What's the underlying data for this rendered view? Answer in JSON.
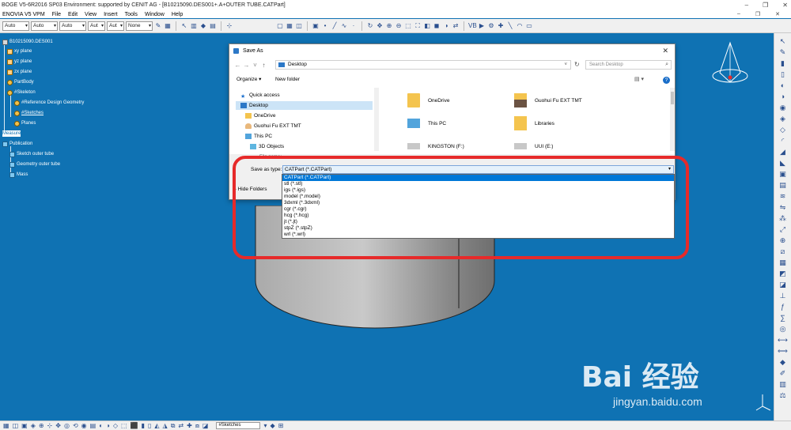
{
  "window": {
    "title": "BOGE V5-6R2016 SP03 Environment: supported by CENIT AG - [B10215090.DES001+.A+OUTER TUBE.CATPart]",
    "controls": [
      "–",
      "❐",
      "✕"
    ]
  },
  "menu": [
    "ENOVIA V5 VPM",
    "File",
    "Edit",
    "View",
    "Insert",
    "Tools",
    "Window",
    "Help"
  ],
  "menu_doc_controls": [
    "–",
    "❐",
    "✕"
  ],
  "toolbar_combos": [
    "Auto",
    "Auto",
    "Auto",
    "Aut",
    "Aut",
    "None"
  ],
  "tree": {
    "root": "B10215090.DES001",
    "xy": "xy plane",
    "yz": "yz plane",
    "zx": "zx plane",
    "partbody": "PartBody",
    "skeleton": "#Skeleton",
    "refgeo": "#Reference Design Geometry",
    "sketches": "#Sketches",
    "planes": "Planes",
    "measure": "Measure",
    "publication": "Publication",
    "sketch_outer": "Sketch outer tube",
    "geom_outer": "Geometry outer tube",
    "mass": "Mass"
  },
  "bottom_field": "#Sketches",
  "dialog": {
    "title": "Save As",
    "close": "✕",
    "location": "Desktop",
    "search_placeholder": "Search Desktop",
    "organize": "Organize ▾",
    "new_folder": "New folder",
    "help": "?",
    "nav": [
      "Quick access",
      "Desktop",
      "OneDrive",
      "Guohui Fu EXT TMT",
      "This PC",
      "3D Objects"
    ],
    "files": [
      "OneDrive",
      "Guohui Fu EXT TMT",
      "This PC",
      "Libraries",
      "KINGSTON (F:)",
      "UUI (E:)"
    ],
    "file_name_label": "File name:",
    "save_type_label": "Save as type:",
    "save_type_value": "CATPart (*.CATPart)",
    "hide_folders": "Hide Folders",
    "types": [
      "CATPart (*.CATPart)",
      "stl (*.stl)",
      "igs (*.igs)",
      "model (*.model)",
      "3dxml (*.3dxml)",
      "cgr (*.cgr)",
      "hcg (*.hcg)",
      "jt (*.jt)",
      "stpZ (*.stpZ)",
      "wrl (*.wrl)"
    ]
  },
  "watermark": {
    "logo": "Bai  经验",
    "url": "jingyan.baidu.com"
  },
  "colors": {
    "viewport": "#0f72b3",
    "highlight": "#e62a2a",
    "selection": "#0078d7"
  }
}
